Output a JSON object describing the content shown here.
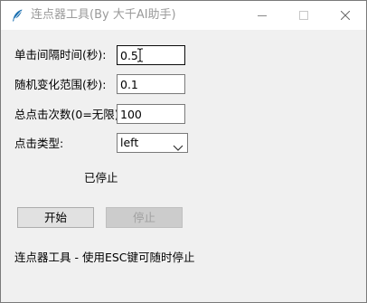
{
  "window": {
    "title": "连点器工具(By 大千AI助手)"
  },
  "form": {
    "interval_label": "单击间隔时间(秒):",
    "interval_value": "0.5",
    "random_label": "随机变化范围(秒):",
    "random_value": "0.1",
    "total_label": "总点击次数(0=无限):",
    "total_value": "100",
    "click_type_label": "点击类型:",
    "click_type_value": "left"
  },
  "status": {
    "text": "已停止"
  },
  "buttons": {
    "start_label": "开始",
    "stop_label": "停止"
  },
  "footer": {
    "text": "连点器工具 - 使用ESC键可随时停止"
  },
  "icons": {
    "app": "feather-icon",
    "minimize": "minimize-icon",
    "maximize": "maximize-icon",
    "close": "close-icon",
    "dropdown": "chevron-down-icon"
  },
  "colors": {
    "window_bg": "#f0f0f0",
    "titlebar_bg": "#ffffff",
    "disabled_text": "#a0a0a0"
  }
}
